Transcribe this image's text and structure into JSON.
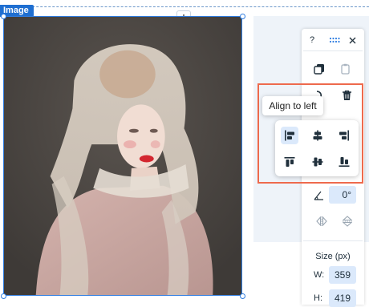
{
  "selection": {
    "label": "Image"
  },
  "image": {
    "description": "portrait photo"
  },
  "panel": {
    "help": "?",
    "tooltip": "Align to left",
    "rotation": "0°",
    "size_title": "Size (px)",
    "width_label": "W:",
    "width_value": "359",
    "height_label": "H:",
    "height_value": "419"
  },
  "colors": {
    "selection": "#2f7de1",
    "highlight": "#ee6a4d",
    "field_bg": "#dbe9fb"
  }
}
